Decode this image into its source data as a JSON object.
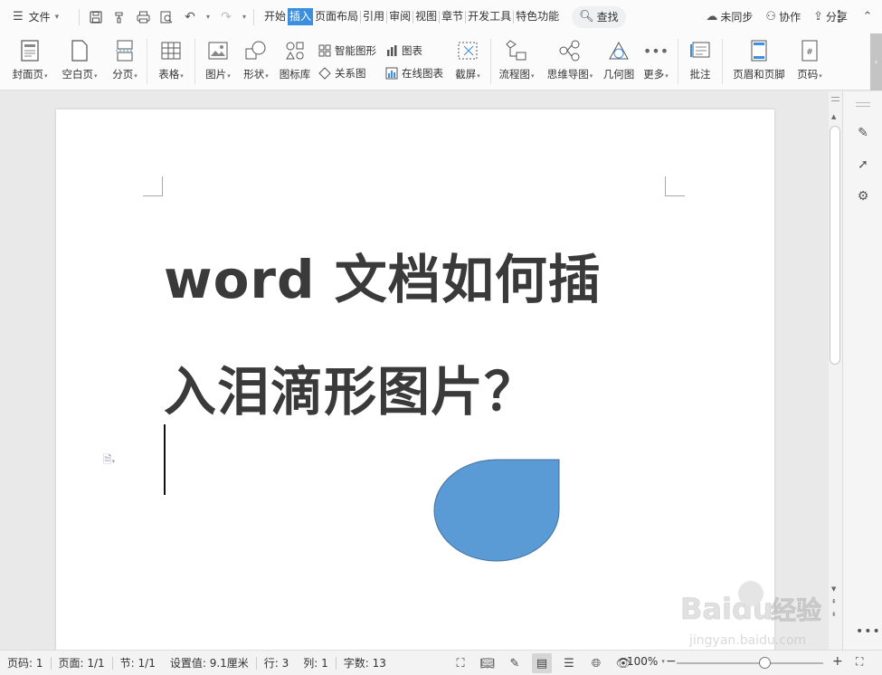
{
  "menu": {
    "file_label": "文件",
    "tabs": [
      {
        "label": "开始",
        "active": false
      },
      {
        "label": "插入",
        "active": true
      },
      {
        "label": "页面布局",
        "active": false
      },
      {
        "label": "引用",
        "active": false
      },
      {
        "label": "审阅",
        "active": false
      },
      {
        "label": "视图",
        "active": false
      },
      {
        "label": "章节",
        "active": false
      },
      {
        "label": "开发工具",
        "active": false
      },
      {
        "label": "特色功能",
        "active": false
      }
    ],
    "search_label": "查找",
    "sync_label": "未同步",
    "collab_label": "协作",
    "share_label": "分享"
  },
  "ribbon": {
    "cover": "封面页",
    "blank": "空白页",
    "pagebreak": "分页",
    "table": "表格",
    "picture": "图片",
    "shape": "形状",
    "iconlib": "图标库",
    "smartart": "智能图形",
    "chart": "图表",
    "relation": "关系图",
    "online_chart": "在线图表",
    "screenshot": "截屏",
    "flowchart": "流程图",
    "mindmap": "思维导图",
    "geometry": "几何图",
    "more": "更多",
    "comment": "批注",
    "header_footer": "页眉和页脚",
    "page_number": "页码"
  },
  "document": {
    "title_line1": "word 文档如何插",
    "title_line2": "入泪滴形图片？",
    "shape_color": "#5b9bd5",
    "shape_border": "#41719c"
  },
  "status": {
    "page": "页码: 1",
    "pages": "页面: 1/1",
    "section": "节: 1/1",
    "setting": "设置值: 9.1厘米",
    "row": "行: 3",
    "col": "列: 1",
    "words": "字数: 13",
    "zoom": "100%",
    "zoom_fraction": 0.6
  },
  "colors": {
    "accent": "#3a8fe0"
  },
  "watermark": {
    "brand": "Baidu",
    "brand_cn": "经验",
    "url": "jingyan.baidu.com"
  }
}
